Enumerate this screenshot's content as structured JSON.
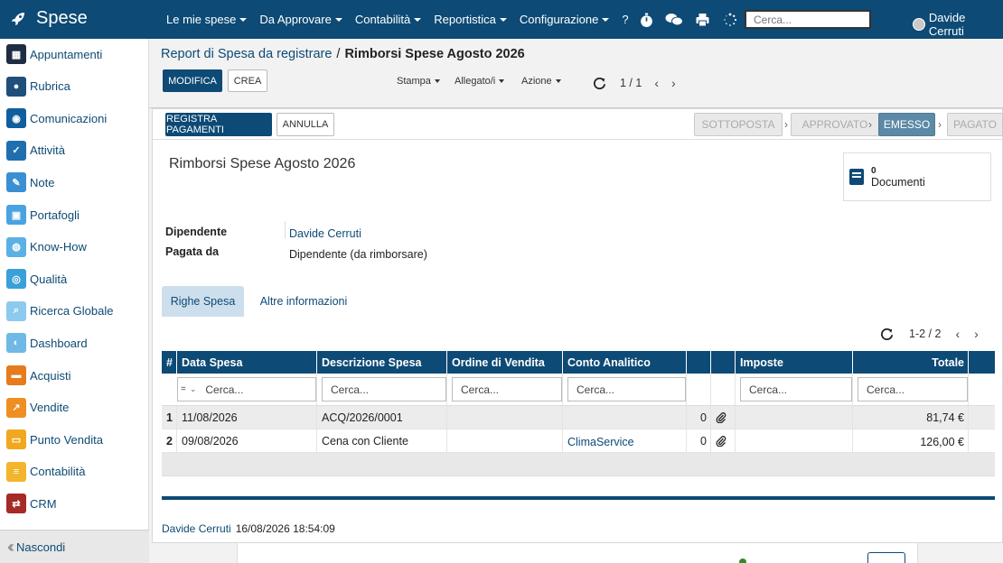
{
  "app": {
    "title": "Spese"
  },
  "menu": [
    {
      "label": "Le mie spese",
      "dropdown": true
    },
    {
      "label": "Da Approvare",
      "dropdown": true
    },
    {
      "label": "Contabilità",
      "dropdown": true
    },
    {
      "label": "Reportistica",
      "dropdown": true
    },
    {
      "label": "Configurazione",
      "dropdown": true
    },
    {
      "label": "?",
      "dropdown": false
    }
  ],
  "topbar": {
    "search_placeholder": "Cerca...",
    "user_name": "Davide Cerruti",
    "icons": [
      "timer-icon",
      "chat-icon",
      "print-icon",
      "spinner-icon"
    ]
  },
  "sidebar": {
    "items": [
      {
        "label": "Appuntamenti",
        "icon": "calendar-icon",
        "color": "#1f2d44"
      },
      {
        "label": "Rubrica",
        "icon": "contacts-icon",
        "color": "#1f4f7a"
      },
      {
        "label": "Comunicazioni",
        "icon": "chat-icon",
        "color": "#0f5f9e"
      },
      {
        "label": "Attività",
        "icon": "checkbox-icon",
        "color": "#1f6fae"
      },
      {
        "label": "Note",
        "icon": "note-icon",
        "color": "#3a8fd3"
      },
      {
        "label": "Portafogli",
        "icon": "lock-icon",
        "color": "#48a3e0"
      },
      {
        "label": "Know-How",
        "icon": "bulb-icon",
        "color": "#5bb0e4"
      },
      {
        "label": "Qualità",
        "icon": "quality-icon",
        "color": "#3aa0d8"
      },
      {
        "label": "Ricerca Globale",
        "icon": "search-icon",
        "color": "#8ccbee"
      },
      {
        "label": "Dashboard",
        "icon": "dashboard-icon",
        "color": "#6fb9e6"
      },
      {
        "label": "Acquisti",
        "icon": "cart-icon",
        "color": "#e77b1b"
      },
      {
        "label": "Vendite",
        "icon": "chart-icon",
        "color": "#ef8f22"
      },
      {
        "label": "Punto Vendita",
        "icon": "pos-icon",
        "color": "#f1a81f"
      },
      {
        "label": "Contabilità",
        "icon": "ledger-icon",
        "color": "#f3b52c"
      },
      {
        "label": "CRM",
        "icon": "handshake-icon",
        "color": "#a62a25"
      }
    ],
    "footer_label": "Nascondi"
  },
  "breadcrumb": {
    "parent": "Report di Spesa da registrare",
    "separator": "/",
    "current": "Rimborsi Spese Agosto 2026"
  },
  "control": {
    "edit_label": "MODIFICA",
    "create_label": "CREA",
    "print_label": "Stampa",
    "attachment_label": "Allegato/i",
    "action_label": "Azione",
    "pager": "1 / 1"
  },
  "header_buttons": {
    "register_payment": "REGISTRA PAGAMENTI",
    "cancel": "ANNULLA"
  },
  "stages": [
    {
      "label": "SOTTOPOSTA",
      "active": false
    },
    {
      "label": "APPROVATO",
      "active": false
    },
    {
      "label": "EMESSO",
      "active": true
    },
    {
      "label": "PAGATO",
      "active": false
    }
  ],
  "sheet": {
    "title": "Rimborsi Spese Agosto 2026",
    "smart_button": {
      "count": "0",
      "label": "Documenti"
    },
    "fields": [
      {
        "label": "Dipendente",
        "value": "Davide Cerruti",
        "link": true
      },
      {
        "label": "Pagata da",
        "value": "Dipendente (da rimborsare)",
        "link": false
      }
    ],
    "tabs": {
      "active": "Righe Spesa",
      "other": "Altre informazioni"
    },
    "list_pager": "1-2 / 2"
  },
  "grid": {
    "columns": {
      "num": "#",
      "date": "Data Spesa",
      "description": "Descrizione Spesa",
      "sale_order": "Ordine di Vendita",
      "analytic": "Conto Analitico",
      "taxes": "Imposte",
      "total": "Totale"
    },
    "filter": {
      "operator": "=",
      "placeholder": "Cerca..."
    },
    "rows": [
      {
        "num": "1",
        "date": "11/08/2026",
        "description": "ACQ/2026/0001",
        "sale_order": "",
        "analytic": "",
        "attachments": "0",
        "taxes": "",
        "total": "81,74 €"
      },
      {
        "num": "2",
        "date": "09/08/2026",
        "description": "Cena con Cliente",
        "sale_order": "",
        "analytic": "ClimaService",
        "attachments": "0",
        "taxes": "",
        "total": "126,00 €"
      }
    ]
  },
  "chatter": {
    "author": "Davide Cerruti",
    "date": "16/08/2026 18:54:09"
  }
}
